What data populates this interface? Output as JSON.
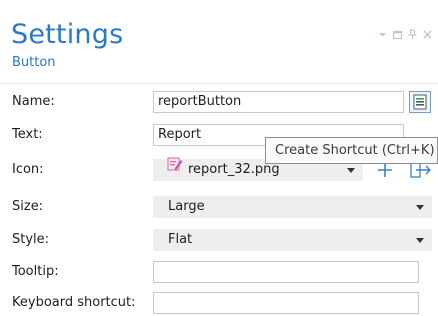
{
  "header": {
    "title": "Settings",
    "subtitle": "Button",
    "controls": [
      "dropdown-icon",
      "maximize-icon",
      "pin-icon",
      "close-icon"
    ]
  },
  "fields": {
    "name": {
      "label": "Name:",
      "value": "reportButton"
    },
    "text": {
      "label": "Text:",
      "value": "Report"
    },
    "icon": {
      "label": "Icon:",
      "value": "report_32.png"
    },
    "size": {
      "label": "Size:",
      "value": "Large"
    },
    "style": {
      "label": "Style:",
      "value": "Flat"
    },
    "tooltip": {
      "label": "Tooltip:",
      "value": ""
    },
    "shortcut": {
      "label": "Keyboard shortcut:",
      "value": ""
    }
  },
  "tooltip_popup": {
    "text": "Create Shortcut (Ctrl+K)"
  },
  "colors": {
    "accent": "#2a79c8",
    "field_border": "#c8c8c8",
    "combo_bg": "#eeeeee"
  }
}
